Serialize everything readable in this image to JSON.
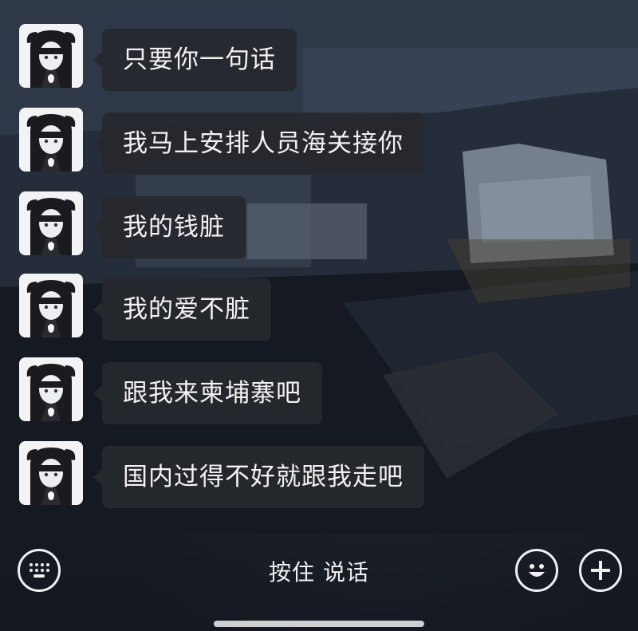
{
  "messages": [
    {
      "text": "只要你一句话"
    },
    {
      "text": "我马上安排人员海关接你"
    },
    {
      "text": "我的钱脏"
    },
    {
      "text": "我的爱不脏"
    },
    {
      "text": "跟我来柬埔寨吧"
    },
    {
      "text": "国内过得不好就跟我走吧"
    }
  ],
  "input_bar": {
    "keyboard_icon": "keyboard-icon",
    "voice_label": "按住 说话",
    "emoji_icon": "emoji-icon",
    "plus_icon": "plus-icon"
  },
  "colors": {
    "bubble": "#26282e",
    "text": "#f2f2f2",
    "background": "#1c2230"
  }
}
